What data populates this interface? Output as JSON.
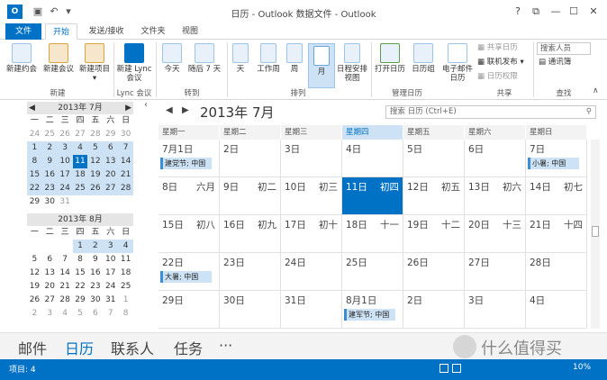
{
  "app": {
    "logo": "O",
    "title": "日历 - Outlook 数据文件 - Outlook"
  },
  "window_controls": [
    "?",
    "⧉",
    "—",
    "☐",
    "✕"
  ],
  "tabs": [
    "文件",
    "开始",
    "发送/接收",
    "文件夹",
    "视图"
  ],
  "ribbon": {
    "new": {
      "items": [
        "新建约会",
        "新建会议",
        "新建项目"
      ],
      "label": "新建"
    },
    "lync": {
      "items": [
        "新建 Lync 会议"
      ],
      "label": "Lync 会议"
    },
    "goto": {
      "items": [
        "今天",
        "随后 7 天"
      ],
      "label": "转到"
    },
    "arrange": {
      "items": [
        "天",
        "工作周",
        "周",
        "月",
        "日程安排视图"
      ],
      "label": "排列"
    },
    "manage": {
      "items": [
        "打开日历",
        "日历组",
        "电子邮件日历"
      ],
      "label": "管理日历"
    },
    "share": {
      "items": [
        "共享日历",
        "联机发布",
        "日历权限"
      ],
      "label": "共享"
    },
    "find": {
      "search_placeholder": "搜索人员",
      "addressbook": "通讯簿",
      "label": "查找"
    }
  },
  "mini_cal": {
    "month1": "2013年 7月",
    "month2": "2013年 8月",
    "weekdays": [
      "一",
      "二",
      "三",
      "四",
      "五",
      "六",
      "日"
    ],
    "m1_days": [
      "24",
      "25",
      "26",
      "27",
      "28",
      "29",
      "30",
      "1",
      "2",
      "3",
      "4",
      "5",
      "6",
      "7",
      "8",
      "9",
      "10",
      "11",
      "12",
      "13",
      "14",
      "15",
      "16",
      "17",
      "18",
      "19",
      "20",
      "21",
      "22",
      "23",
      "24",
      "25",
      "26",
      "27",
      "28",
      "29",
      "30",
      "31"
    ],
    "m2_days": [
      "",
      "",
      "",
      "1",
      "2",
      "3",
      "4",
      "5",
      "6",
      "7",
      "8",
      "9",
      "10",
      "11",
      "12",
      "13",
      "14",
      "15",
      "16",
      "17",
      "18",
      "19",
      "20",
      "21",
      "22",
      "23",
      "24",
      "25",
      "26",
      "27",
      "28",
      "29",
      "30",
      "31",
      "1",
      "2",
      "3",
      "4",
      "5",
      "6",
      "7",
      "8"
    ]
  },
  "calendar": {
    "title": "2013年 7月",
    "search_placeholder": "搜索 日历 (Ctrl+E)",
    "weekday_headers": [
      "星期一",
      "星期二",
      "星期三",
      "星期四",
      "星期五",
      "星期六",
      "星期日"
    ],
    "weeks": [
      [
        {
          "d": "7月1日",
          "l": ""
        },
        {
          "d": "2日",
          "l": ""
        },
        {
          "d": "3日",
          "l": ""
        },
        {
          "d": "4日",
          "l": ""
        },
        {
          "d": "5日",
          "l": ""
        },
        {
          "d": "6日",
          "l": ""
        },
        {
          "d": "7日",
          "l": ""
        }
      ],
      [
        {
          "d": "8日",
          "l": "六月"
        },
        {
          "d": "9日",
          "l": "初二"
        },
        {
          "d": "10日",
          "l": "初三"
        },
        {
          "d": "11日",
          "l": "初四"
        },
        {
          "d": "12日",
          "l": "初五"
        },
        {
          "d": "13日",
          "l": "初六"
        },
        {
          "d": "14日",
          "l": "初七"
        }
      ],
      [
        {
          "d": "15日",
          "l": "初八"
        },
        {
          "d": "16日",
          "l": "初九"
        },
        {
          "d": "17日",
          "l": "初十"
        },
        {
          "d": "18日",
          "l": "十一"
        },
        {
          "d": "19日",
          "l": "十二"
        },
        {
          "d": "20日",
          "l": "十三"
        },
        {
          "d": "21日",
          "l": "十四"
        }
      ],
      [
        {
          "d": "22日",
          "l": ""
        },
        {
          "d": "23日",
          "l": ""
        },
        {
          "d": "24日",
          "l": ""
        },
        {
          "d": "25日",
          "l": ""
        },
        {
          "d": "26日",
          "l": ""
        },
        {
          "d": "27日",
          "l": ""
        },
        {
          "d": "28日",
          "l": ""
        }
      ],
      [
        {
          "d": "29日",
          "l": ""
        },
        {
          "d": "30日",
          "l": ""
        },
        {
          "d": "31日",
          "l": ""
        },
        {
          "d": "8月1日",
          "l": ""
        },
        {
          "d": "2日",
          "l": ""
        },
        {
          "d": "3日",
          "l": ""
        },
        {
          "d": "4日",
          "l": ""
        }
      ]
    ],
    "events": [
      "建党节; 中国",
      "小暑; 中国",
      "大暑; 中国",
      "建军节; 中国"
    ]
  },
  "nav": [
    "邮件",
    "日历",
    "联系人",
    "任务",
    "···"
  ],
  "status": {
    "items": "项目: 4",
    "zoom": "10%"
  },
  "watermark": "什么值得买"
}
